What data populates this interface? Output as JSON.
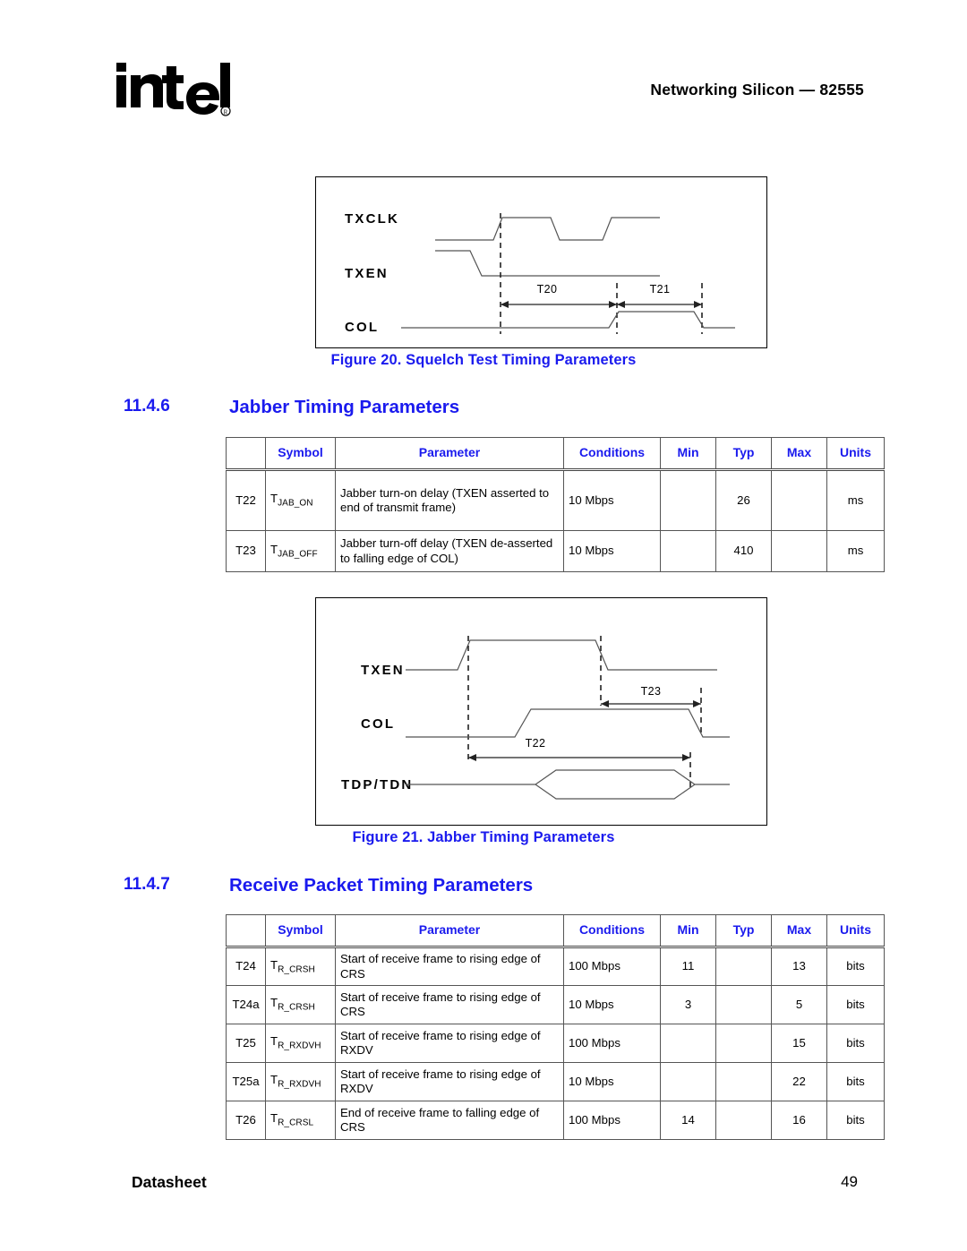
{
  "header": {
    "logo_text": "intel",
    "logo_mark": "registered-trademark",
    "title": "Networking Silicon — 82555"
  },
  "figures": [
    {
      "id": "figure-20",
      "caption": "Figure 20. Squelch Test Timing Parameters",
      "signals": [
        "TXCLK",
        "TXEN",
        "COL"
      ],
      "time_markers": [
        "T20",
        "T21"
      ]
    },
    {
      "id": "figure-21",
      "caption": "Figure 21. Jabber Timing Parameters",
      "signals": [
        "TXEN",
        "COL",
        "TDP/TDN"
      ],
      "time_markers": [
        "T23",
        "T22"
      ]
    }
  ],
  "sections": [
    {
      "number": "11.4.6",
      "title": "Jabber Timing Parameters"
    },
    {
      "number": "11.4.7",
      "title": "Receive Packet Timing Parameters"
    }
  ],
  "tables": {
    "jabber": {
      "columns": [
        "",
        "Symbol",
        "Parameter",
        "Conditions",
        "Min",
        "Typ",
        "Max",
        "Units"
      ],
      "rows": [
        {
          "id": "T22",
          "symbol_base": "T",
          "symbol_sub": "JAB_ON",
          "parameter": "Jabber turn-on delay (TXEN asserted to end of transmit frame)",
          "conditions": "10 Mbps",
          "min": "",
          "typ": "26",
          "max": "",
          "units": "ms"
        },
        {
          "id": "T23",
          "symbol_base": "T",
          "symbol_sub": "JAB_OFF",
          "parameter": "Jabber turn-off delay (TXEN de-asserted to falling edge of COL)",
          "conditions": "10 Mbps",
          "min": "",
          "typ": "410",
          "max": "",
          "units": "ms"
        }
      ]
    },
    "receive_packet": {
      "columns": [
        "",
        "Symbol",
        "Parameter",
        "Conditions",
        "Min",
        "Typ",
        "Max",
        "Units"
      ],
      "rows": [
        {
          "id": "T24",
          "symbol_base": "T",
          "symbol_sub": "R_CRSH",
          "parameter": "Start of receive frame to rising edge of CRS",
          "conditions": "100 Mbps",
          "min": "11",
          "typ": "",
          "max": "13",
          "units": "bits"
        },
        {
          "id": "T24a",
          "symbol_base": "T",
          "symbol_sub": "R_CRSH",
          "parameter": "Start of receive frame to rising edge of CRS",
          "conditions": "10 Mbps",
          "min": "3",
          "typ": "",
          "max": "5",
          "units": "bits"
        },
        {
          "id": "T25",
          "symbol_base": "T",
          "symbol_sub": "R_RXDVH",
          "parameter": "Start of receive frame to rising edge of RXDV",
          "conditions": "100 Mbps",
          "min": "",
          "typ": "",
          "max": "15",
          "units": "bits"
        },
        {
          "id": "T25a",
          "symbol_base": "T",
          "symbol_sub": "R_RXDVH",
          "parameter": "Start of receive frame to rising edge of RXDV",
          "conditions": "10 Mbps",
          "min": "",
          "typ": "",
          "max": "22",
          "units": "bits"
        },
        {
          "id": "T26",
          "symbol_base": "T",
          "symbol_sub": "R_CRSL",
          "parameter": "End of receive frame to falling edge of CRS",
          "conditions": "100 Mbps",
          "min": "14",
          "typ": "",
          "max": "16",
          "units": "bits"
        }
      ]
    }
  },
  "footer": {
    "label": "Datasheet",
    "page": "49"
  },
  "colors": {
    "heading_blue": "#1a1aee",
    "text_black": "#000000",
    "waveform_gray": "#555555"
  }
}
